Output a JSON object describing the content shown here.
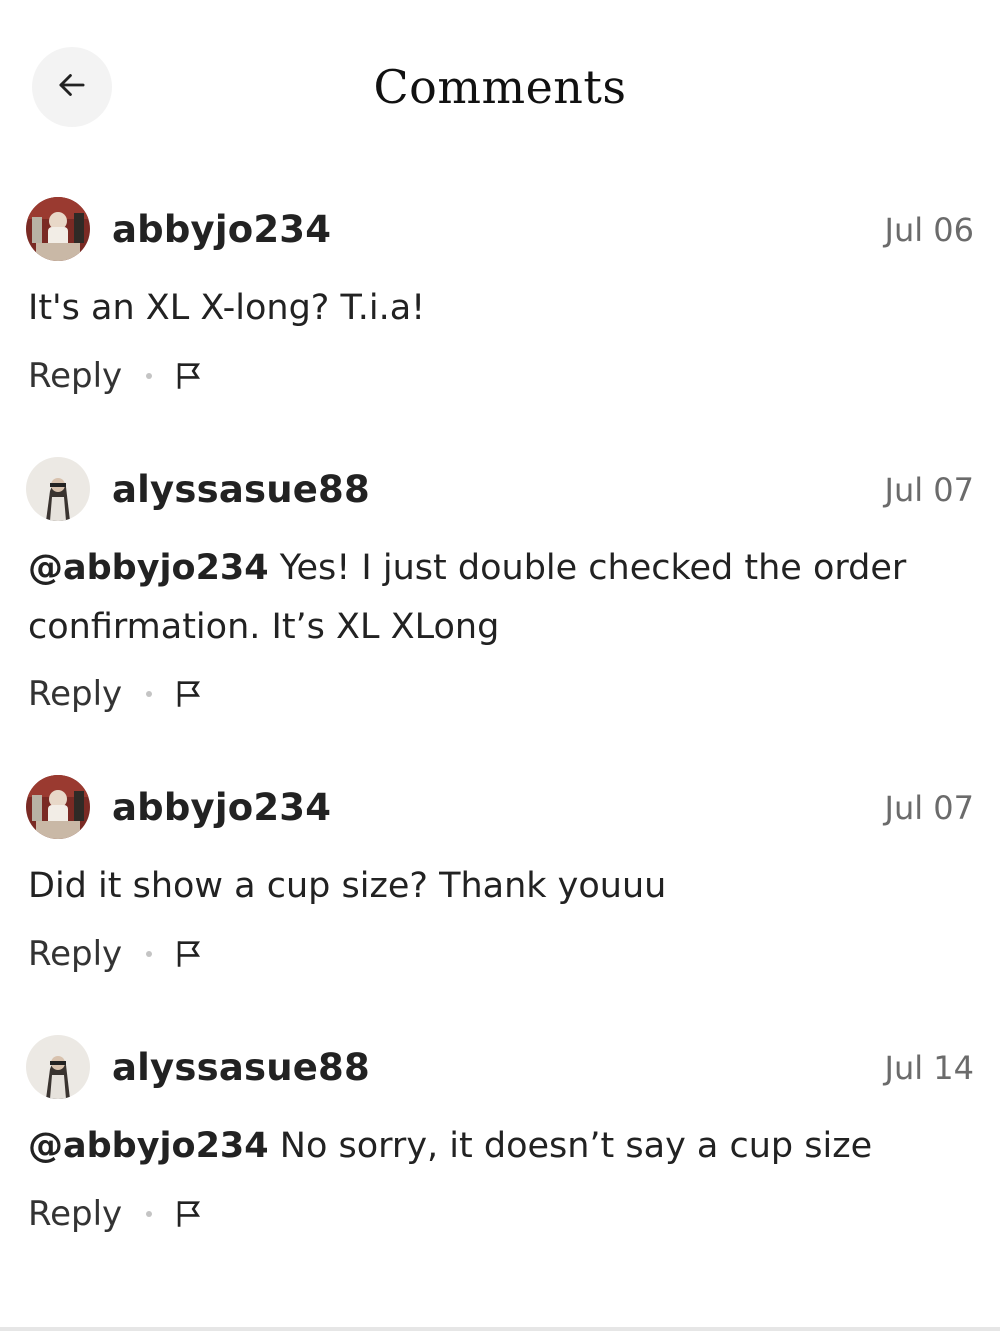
{
  "header": {
    "title": "Comments",
    "back_icon": "arrow-left-icon"
  },
  "comments": [
    {
      "username": "abbyjo234",
      "date": "Jul 06",
      "mention": "",
      "text": "It's an XL X-long? T.i.a!",
      "reply_label": "Reply",
      "flag_icon": "flag-icon",
      "avatar_icon": "avatar-photo-abbyjo234"
    },
    {
      "username": "alyssasue88",
      "date": "Jul 07",
      "mention": "@abbyjo234",
      "text": " Yes! I just double checked the order confirmation. It’s XL XLong",
      "reply_label": "Reply",
      "flag_icon": "flag-icon",
      "avatar_icon": "avatar-photo-alyssasue88"
    },
    {
      "username": "abbyjo234",
      "date": "Jul 07",
      "mention": "",
      "text": "Did it show a cup size? Thank youuu",
      "reply_label": "Reply",
      "flag_icon": "flag-icon",
      "avatar_icon": "avatar-photo-abbyjo234"
    },
    {
      "username": "alyssasue88",
      "date": "Jul 14",
      "mention": "@abbyjo234",
      "text": " No sorry, it doesn’t say a cup size",
      "reply_label": "Reply",
      "flag_icon": "flag-icon",
      "avatar_icon": "avatar-photo-alyssasue88"
    }
  ],
  "colors": {
    "background": "#ffffff",
    "text": "#222222",
    "date": "#6b6b6b",
    "back_button_bg": "#f3f3f3"
  }
}
